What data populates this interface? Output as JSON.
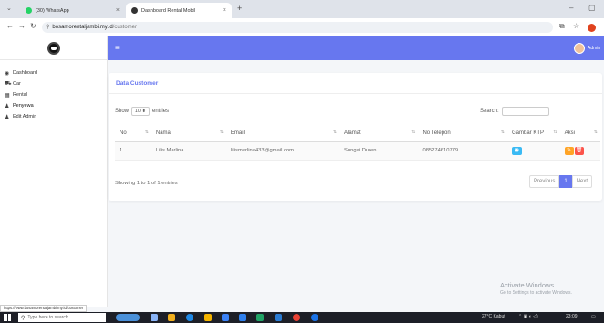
{
  "browser": {
    "tabs": [
      {
        "label": "(30) WhatsApp",
        "favicon_color": "#25d366"
      },
      {
        "label": "Dashboard Rental Mobil",
        "favicon_color": "#333333"
      }
    ],
    "new_tab": "+",
    "url_host": "bosamorentaljambi.my.id",
    "url_path": "/customer",
    "status_url": "https://www.bosamorentaljambi.my.id/customer"
  },
  "sidebar": {
    "items": [
      {
        "icon": "◉",
        "label": "Dashboard",
        "icon_name": "dashboard-icon"
      },
      {
        "icon": "⛟",
        "label": "Car",
        "icon_name": "car-icon"
      },
      {
        "icon": "▦",
        "label": "Rental",
        "icon_name": "rental-icon"
      },
      {
        "icon": "♟",
        "label": "Penyewa",
        "icon_name": "user-icon"
      },
      {
        "icon": "♟",
        "label": "Edit Admin",
        "icon_name": "user-edit-icon"
      }
    ]
  },
  "topnav": {
    "user_label": "Admin",
    "accent": "#6777ef"
  },
  "card": {
    "title": "Data Customer",
    "show_prefix": "Show",
    "show_value": "10 ⬍",
    "show_suffix": "entries",
    "search_label": "Search:",
    "columns": [
      "No",
      "Nama",
      "Email",
      "Alamat",
      "No Telepon",
      "Gambar KTP",
      "Aksi"
    ],
    "rows": [
      {
        "no": "1",
        "nama": "Lilis Marlina",
        "email": "lilismarlina433@gmail.com",
        "alamat": "Sungai Duren",
        "telepon": "085274610779"
      }
    ],
    "info": "Showing 1 to 1 of 1 entries",
    "pager": {
      "prev": "Previous",
      "current": "1",
      "next": "Next"
    }
  },
  "watermark": {
    "title": "Activate Windows",
    "subtitle": "Go to Settings to activate Windows."
  },
  "taskbar": {
    "search_placeholder": "Type here to search",
    "weather": "27°C Kabut",
    "time": "23:09"
  }
}
